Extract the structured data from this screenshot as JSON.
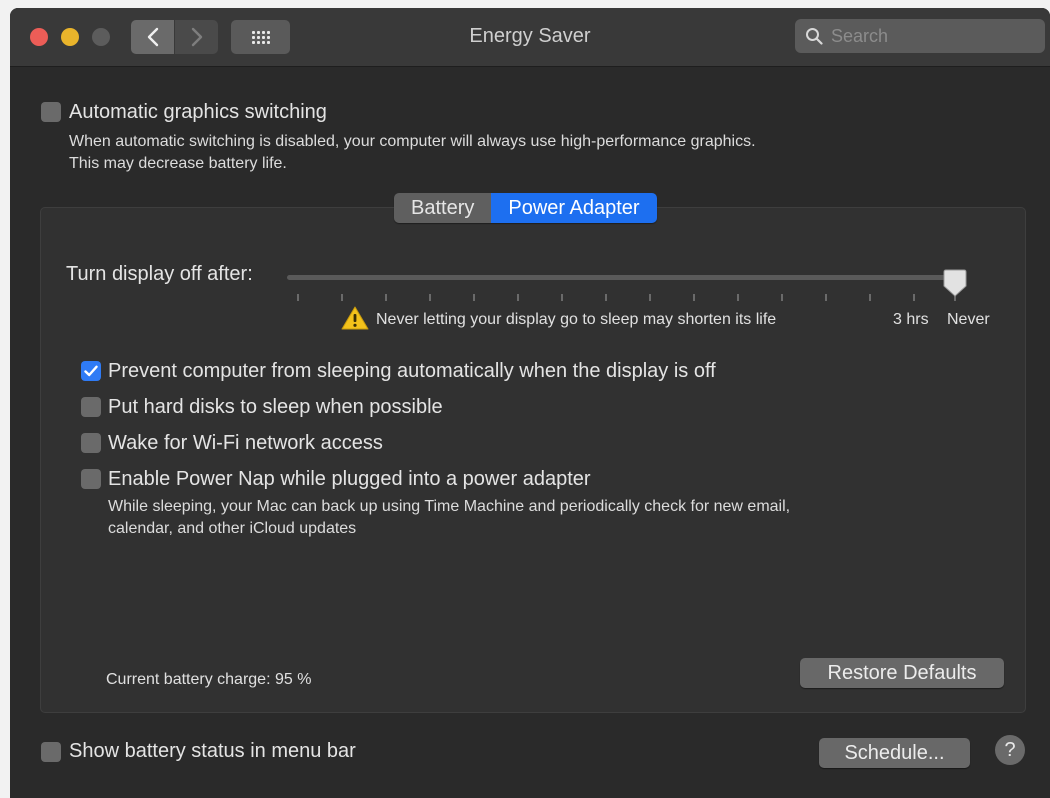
{
  "window": {
    "title": "Energy Saver"
  },
  "search": {
    "placeholder": "Search"
  },
  "graphics": {
    "label": "Automatic graphics switching",
    "checked": false,
    "desc_line1": "When automatic switching is disabled, your computer will always use high-performance graphics.",
    "desc_line2": "This may decrease battery life."
  },
  "tabs": [
    {
      "label": "Battery",
      "active": false
    },
    {
      "label": "Power Adapter",
      "active": true
    }
  ],
  "display_off": {
    "label": "Turn display off after:",
    "value_label": "Never",
    "warning": "Never letting your display go to sleep may shorten its life",
    "tick_labels": [
      "3 hrs",
      "Never"
    ]
  },
  "options": [
    {
      "label": "Prevent computer from sleeping automatically when the display is off",
      "checked": true
    },
    {
      "label": "Put hard disks to sleep when possible",
      "checked": false
    },
    {
      "label": "Wake for Wi-Fi network access",
      "checked": false
    },
    {
      "label": "Enable Power Nap while plugged into a power adapter",
      "checked": false,
      "desc_line1": "While sleeping, your Mac can back up using Time Machine and periodically check for new email,",
      "desc_line2": "calendar, and other iCloud updates"
    }
  ],
  "battery_charge": "Current battery charge: 95 %",
  "buttons": {
    "restore": "Restore Defaults",
    "schedule": "Schedule...",
    "help": "?"
  },
  "menu_bar_status": {
    "label": "Show battery status in menu bar",
    "checked": false
  },
  "colors": {
    "accent": "#1d6ff0",
    "window_bg": "#2a2a2a",
    "warning": "#f3c21b"
  }
}
